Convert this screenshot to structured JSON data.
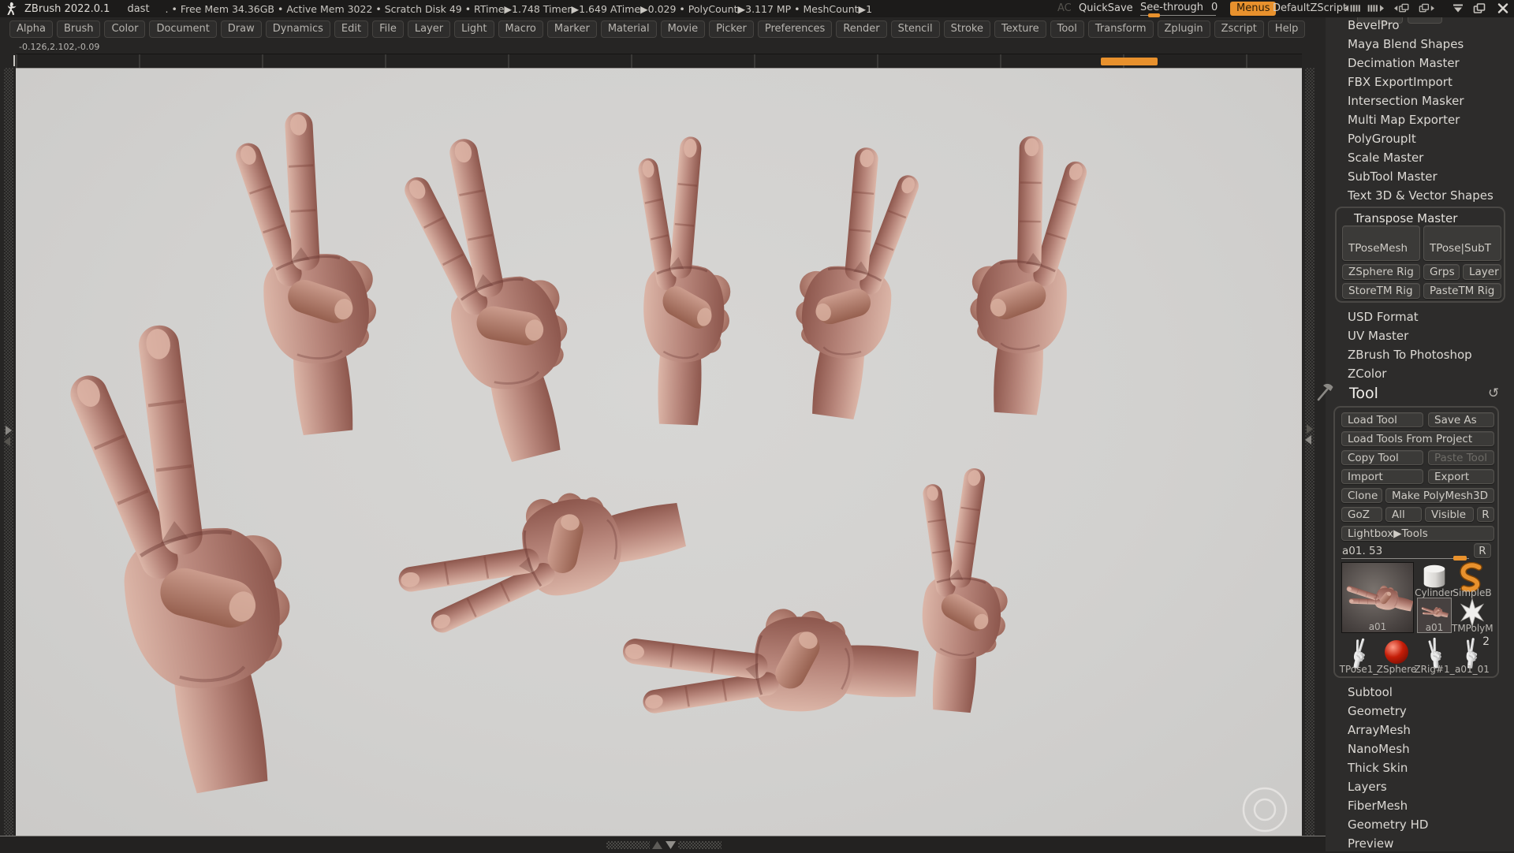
{
  "titlebar": {
    "app_title": "ZBrush 2022.0.1",
    "document_name": "dast",
    "stats": ".  •  Free Mem 34.36GB  •  Active Mem 3022  •  Scratch Disk 49  •   RTime▶1.748 Timer▶1.649 ATime▶0.029  •  PolyCount▶3.117 MP   •  MeshCount▶1",
    "ac_label": "AC",
    "quicksave_label": "QuickSave",
    "see_through_label": "See-through",
    "see_through_value": "0",
    "menus_label": "Menus",
    "zscript_label": "DefaultZScript"
  },
  "menubar": {
    "items": [
      "Alpha",
      "Brush",
      "Color",
      "Document",
      "Draw",
      "Dynamics",
      "Edit",
      "File",
      "Layer",
      "Light",
      "Macro",
      "Marker",
      "Material",
      "Movie",
      "Picker",
      "Preferences",
      "Render",
      "Stencil",
      "Stroke",
      "Texture",
      "Tool",
      "Transform",
      "Zplugin",
      "Zscript",
      "Help"
    ]
  },
  "canvas": {
    "coordinates": "-0.126,2.102,-0.09"
  },
  "plugin_list": {
    "items": [
      "BevelPro",
      "Maya Blend Shapes",
      "Decimation Master",
      "FBX ExportImport",
      "Intersection Masker",
      "Multi Map Exporter",
      "PolyGroupIt",
      "Scale Master",
      "SubTool Master",
      "Text 3D & Vector Shapes"
    ]
  },
  "transpose_master": {
    "title": "Transpose Master",
    "tpose_mesh": "TPoseMesh",
    "tpose_subt": "TPose|SubT",
    "zsphere_rig": "ZSphere Rig",
    "grps": "Grps",
    "layer": "Layer",
    "store_tm_rig": "StoreTM Rig",
    "paste_tm_rig": "PasteTM Rig"
  },
  "plugin_list_2": {
    "items": [
      "USD Format",
      "UV Master",
      "ZBrush To Photoshop",
      "ZColor"
    ]
  },
  "tool": {
    "title": "Tool",
    "load_tool": "Load Tool",
    "save_as": "Save As",
    "load_tools_from_project": "Load Tools From Project",
    "copy_tool": "Copy Tool",
    "paste_tool": "Paste Tool",
    "import_label": "Import",
    "export_label": "Export",
    "clone": "Clone",
    "make_polymesh3d": "Make PolyMesh3D",
    "goz": "GoZ",
    "all": "All",
    "visible": "Visible",
    "r": "R",
    "lightbox_tools": "Lightbox▶Tools",
    "slider_label": "a01. 53",
    "slider_r": "R",
    "thumbnails": {
      "active": "a01",
      "cylinder": "Cylinder",
      "simpleb": "SimpleB",
      "a01_small": "a01",
      "tmpolym": "TMPolyM",
      "tpose1": "TPose1_",
      "zsphere": "ZSphere",
      "zrig1": "ZRig#1_",
      "a01_01": "a01_01",
      "badge": "2"
    }
  },
  "tool_sections": {
    "items": [
      "Subtool",
      "Geometry",
      "ArrayMesh",
      "NanoMesh",
      "Thick Skin",
      "Layers",
      "FiberMesh",
      "Geometry HD",
      "Preview"
    ]
  },
  "colors": {
    "accent_orange": "#e8912d",
    "canvas_bg": "#d2d1cf",
    "clay_skin": "#b7857a"
  }
}
